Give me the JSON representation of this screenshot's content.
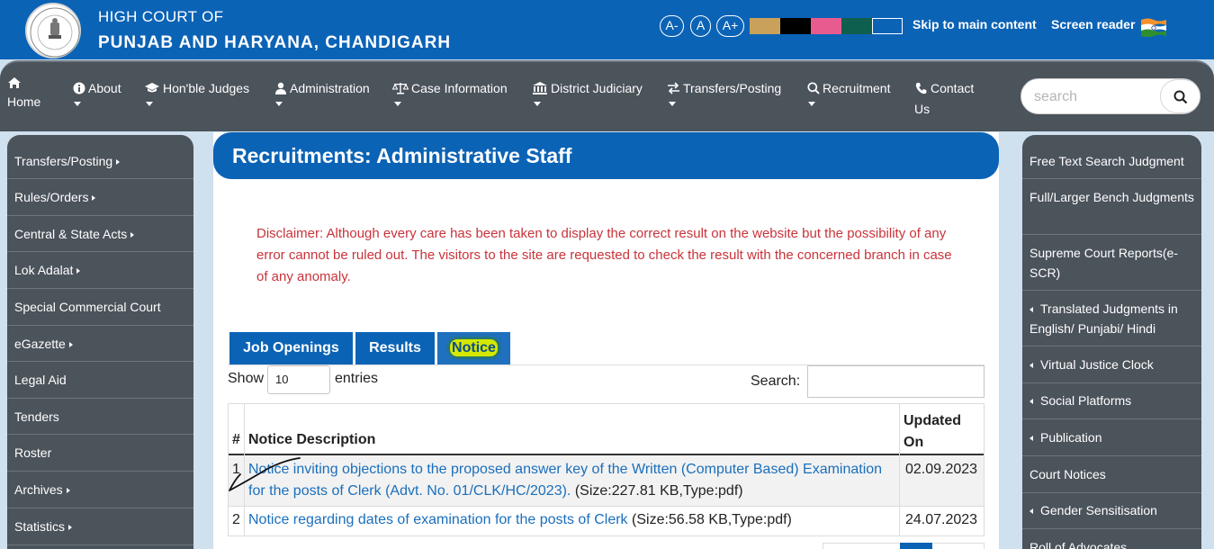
{
  "header": {
    "court_line1": "HIGH COURT OF",
    "court_line2": "PUNJAB AND HARYANA, CHANDIGARH",
    "font_decrease": "A-",
    "font_normal": "A",
    "font_increase": "A+",
    "color_swatches": [
      "#c9a15a",
      "#000000",
      "#e85b8e",
      "#0f5f4f",
      "#0b63b6"
    ],
    "skip_link": "Skip to main content",
    "screen_reader": "Screen reader"
  },
  "nav": {
    "items": [
      {
        "label": "Home",
        "icon": "home-icon"
      },
      {
        "label": "About",
        "icon": "info-icon"
      },
      {
        "label": "Hon'ble Judges",
        "icon": "graduation-cap-icon"
      },
      {
        "label": "Administration",
        "icon": "user-icon"
      },
      {
        "label": "Case Information",
        "icon": "scales-icon"
      },
      {
        "label": "District Judiciary",
        "icon": "building-icon"
      },
      {
        "label": "Transfers/Posting",
        "icon": "exchange-icon"
      },
      {
        "label": "Recruitment",
        "icon": "search-icon"
      },
      {
        "label": "Contact",
        "label2": "Us",
        "icon": "phone-icon"
      }
    ],
    "search_placeholder": "search"
  },
  "left_sidebar": {
    "items": [
      {
        "label": "Transfers/Posting"
      },
      {
        "label": "Rules/Orders"
      },
      {
        "label": "Central & State Acts"
      },
      {
        "label": "Lok Adalat"
      },
      {
        "label": "Special Commercial Court"
      },
      {
        "label": "eGazette"
      },
      {
        "label": "Legal Aid"
      },
      {
        "label": "Tenders"
      },
      {
        "label": "Roster"
      },
      {
        "label": "Archives"
      },
      {
        "label": "Statistics"
      }
    ]
  },
  "right_sidebar": {
    "items": [
      {
        "label": "Free Text Search Judgment"
      },
      {
        "label": "Full/Larger Bench Judgments"
      },
      {
        "label": "Supreme Court Reports(e-SCR)"
      },
      {
        "label": "Translated Judgments in English/ Punjabi/ Hindi"
      },
      {
        "label": "Virtual Justice Clock"
      },
      {
        "label": "Social Platforms"
      },
      {
        "label": "Publication"
      },
      {
        "label": "Court Notices"
      },
      {
        "label": "Gender Sensitisation"
      },
      {
        "label": "Roll of Advocates"
      }
    ]
  },
  "main": {
    "title": "Recruitments: Administrative Staff",
    "disclaimer": "Disclaimer: Although every care has been taken to display the correct result on the website but the possibility of any error cannot be ruled out. The visitors to the site are requested to check the result with the concerned branch in case of any anomaly.",
    "tabs": [
      {
        "label": "Job Openings"
      },
      {
        "label": "Results"
      },
      {
        "label": "Notice"
      }
    ],
    "show_label": "Show",
    "entries_value": "10",
    "entries_label": "entries",
    "search_label": "Search:",
    "table": {
      "headers": [
        "#",
        "Notice Description",
        "Updated On"
      ],
      "rows": [
        {
          "num": "1",
          "link": "Notice inviting objections to the proposed answer key of the Written (Computer Based) Examination for the posts of Clerk (Advt. No. 01/CLK/HC/2023).",
          "meta": " (Size:227.81 KB,Type:pdf)",
          "date": "02.09.2023"
        },
        {
          "num": "2",
          "link": "Notice regarding dates of examination for the posts of Clerk",
          "meta": " (Size:56.58 KB,Type:pdf)",
          "date": "24.07.2023"
        }
      ]
    }
  }
}
